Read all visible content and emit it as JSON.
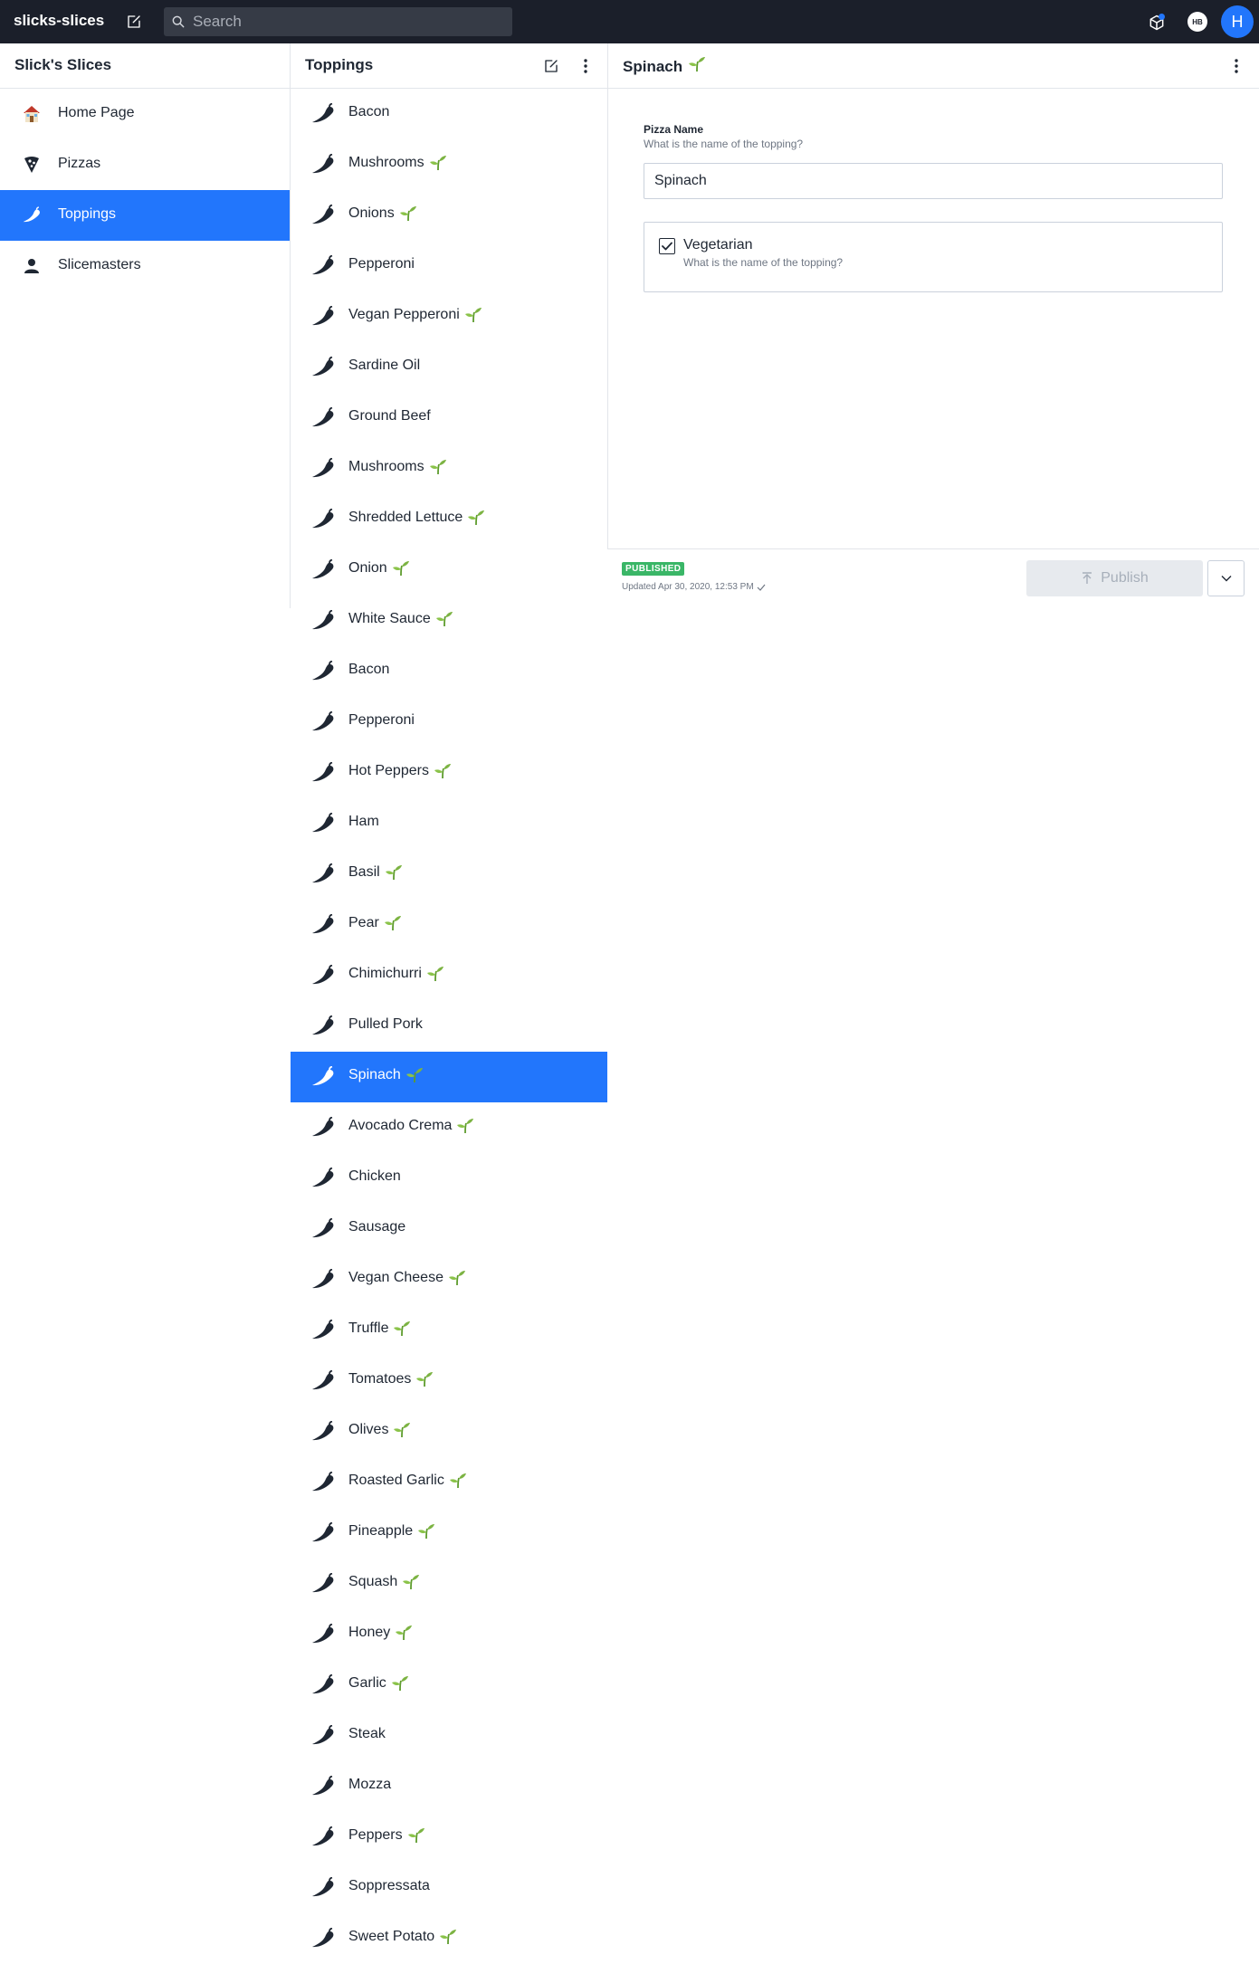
{
  "topbar": {
    "project_title": "slicks-slices",
    "search_placeholder": "Search",
    "user_initials_small": "HB",
    "user_initial": "H"
  },
  "nav_pane": {
    "title": "Slick's Slices",
    "items": [
      {
        "label": "Home Page",
        "icon": "house-emoji-icon"
      },
      {
        "label": "Pizzas",
        "icon": "pizza-slice-icon"
      },
      {
        "label": "Toppings",
        "icon": "pepper-icon",
        "active": true
      },
      {
        "label": "Slicemasters",
        "icon": "person-icon"
      }
    ]
  },
  "toppings_pane": {
    "title": "Toppings",
    "items": [
      {
        "name": "Bacon",
        "vegetarian": false
      },
      {
        "name": "Mushrooms",
        "vegetarian": true
      },
      {
        "name": "Onions",
        "vegetarian": true
      },
      {
        "name": "Pepperoni",
        "vegetarian": false
      },
      {
        "name": "Vegan Pepperoni",
        "vegetarian": true
      },
      {
        "name": "Sardine Oil",
        "vegetarian": false
      },
      {
        "name": "Ground Beef",
        "vegetarian": false
      },
      {
        "name": "Mushrooms",
        "vegetarian": true
      },
      {
        "name": "Shredded Lettuce",
        "vegetarian": true
      },
      {
        "name": "Onion",
        "vegetarian": true
      },
      {
        "name": "White Sauce",
        "vegetarian": true
      },
      {
        "name": "Bacon",
        "vegetarian": false
      },
      {
        "name": "Pepperoni",
        "vegetarian": false
      },
      {
        "name": "Hot Peppers",
        "vegetarian": true
      },
      {
        "name": "Ham",
        "vegetarian": false
      },
      {
        "name": "Basil",
        "vegetarian": true
      },
      {
        "name": "Pear",
        "vegetarian": true
      },
      {
        "name": "Chimichurri",
        "vegetarian": true
      },
      {
        "name": "Pulled Pork",
        "vegetarian": false
      },
      {
        "name": "Spinach",
        "vegetarian": true,
        "active": true
      },
      {
        "name": "Avocado Crema",
        "vegetarian": true
      },
      {
        "name": "Chicken",
        "vegetarian": false
      },
      {
        "name": "Sausage",
        "vegetarian": false
      },
      {
        "name": "Vegan Cheese",
        "vegetarian": true
      },
      {
        "name": "Truffle",
        "vegetarian": true
      },
      {
        "name": "Tomatoes",
        "vegetarian": true
      },
      {
        "name": "Olives",
        "vegetarian": true
      },
      {
        "name": "Roasted Garlic",
        "vegetarian": true
      },
      {
        "name": "Pineapple",
        "vegetarian": true
      },
      {
        "name": "Squash",
        "vegetarian": true
      },
      {
        "name": "Honey",
        "vegetarian": true
      },
      {
        "name": "Garlic",
        "vegetarian": true
      },
      {
        "name": "Steak",
        "vegetarian": false
      },
      {
        "name": "Mozza",
        "vegetarian": false
      },
      {
        "name": "Peppers",
        "vegetarian": true
      },
      {
        "name": "Soppressata",
        "vegetarian": false
      },
      {
        "name": "Sweet Potato",
        "vegetarian": true
      }
    ]
  },
  "editor": {
    "title": "Spinach",
    "title_vegetarian": true,
    "name_field": {
      "label": "Pizza Name",
      "description": "What is the name of the topping?",
      "value": "Spinach"
    },
    "vegetarian_field": {
      "label": "Vegetarian",
      "description": "What is the name of the topping?",
      "checked": true
    },
    "footer": {
      "status_badge": "PUBLISHED",
      "updated_text": "Updated Apr 30, 2020, 12:53 PM",
      "publish_label": "Publish"
    }
  },
  "colors": {
    "topbar_bg": "#1b1f2a",
    "accent": "#2276fc",
    "published_green": "#3ab667",
    "sprout_green": "#7cb342"
  }
}
